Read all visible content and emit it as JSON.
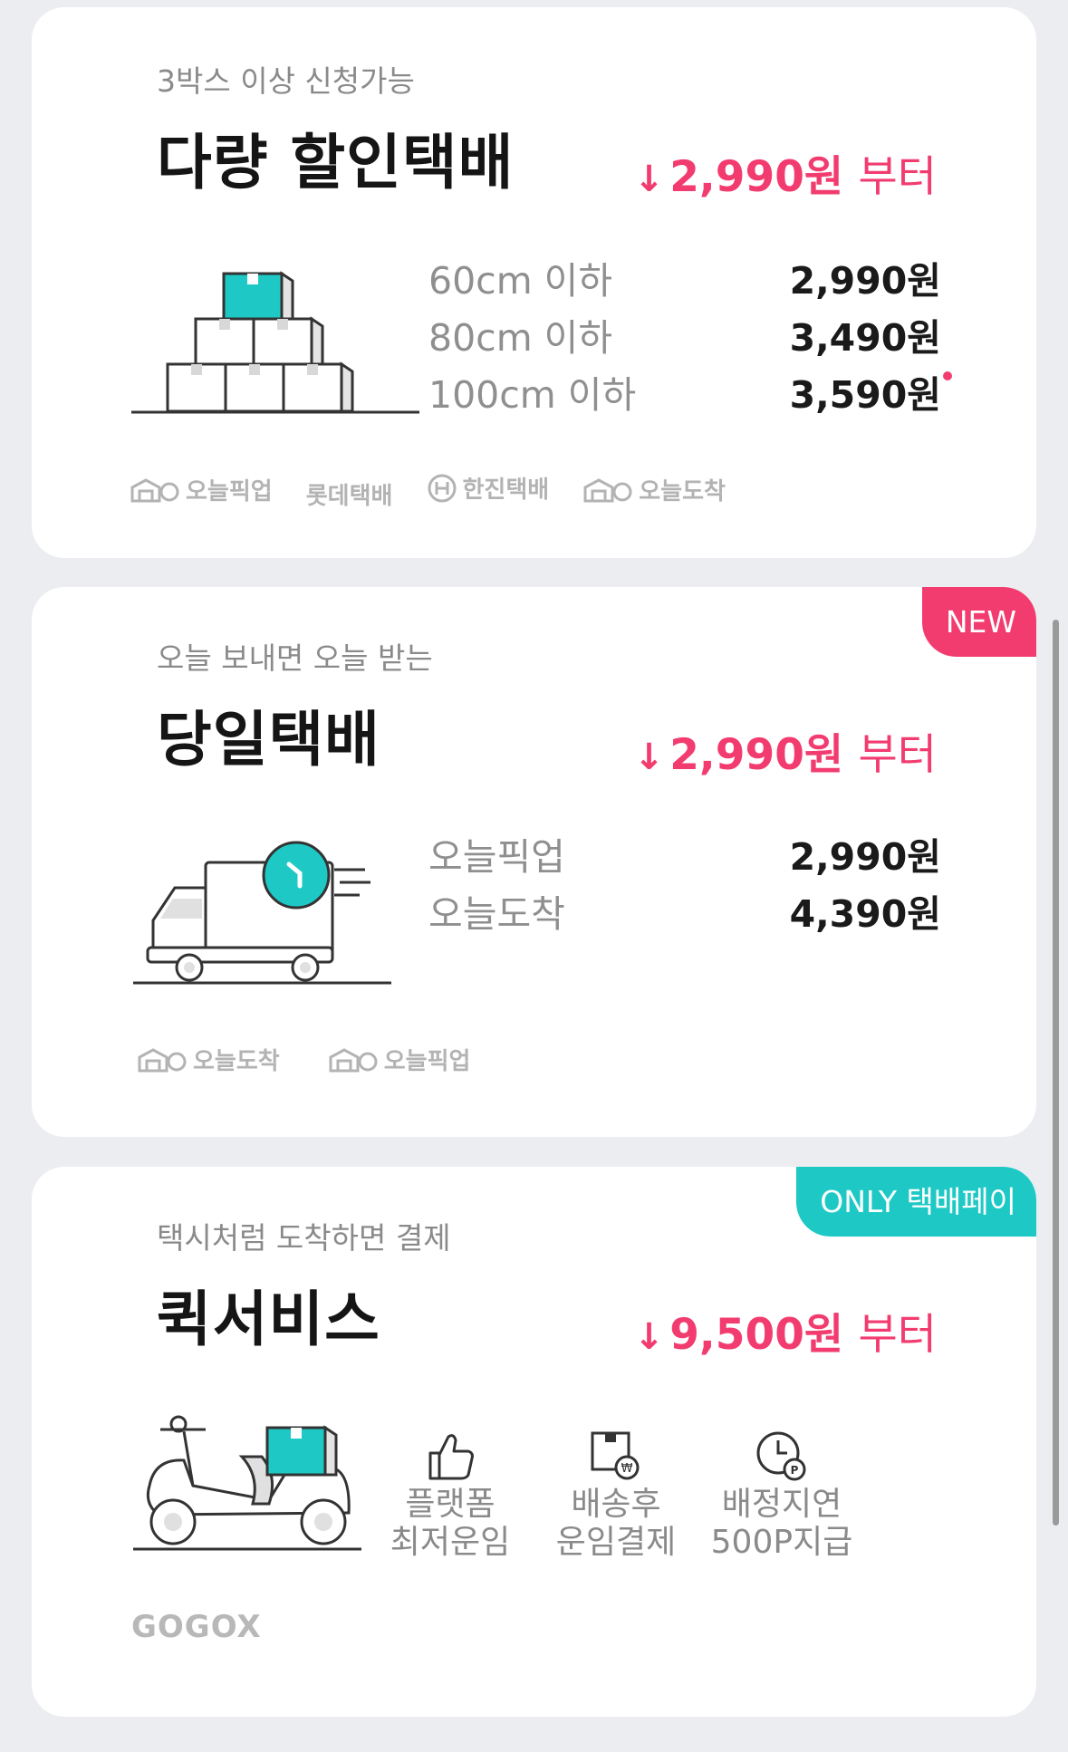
{
  "cards": [
    {
      "subtitle": "3박스 이상 신청가능",
      "title": "다량 할인택배",
      "from_arrow": "↓",
      "from_price": "2,990원",
      "from_word": "부터",
      "rows": [
        {
          "label": "60cm 이하",
          "price": "2,990원"
        },
        {
          "label": "80cm 이하",
          "price": "3,490원"
        },
        {
          "label": "100cm 이하",
          "price": "3,590원"
        }
      ],
      "carriers": [
        "오늘픽업",
        "롯데택배",
        "한진택배",
        "오늘도착"
      ],
      "illustration_icon": "box-pyramid-icon"
    },
    {
      "badge": "NEW",
      "subtitle": "오늘 보내면 오늘 받는",
      "title": "당일택배",
      "from_arrow": "↓",
      "from_price": "2,990원",
      "from_word": "부터",
      "rows": [
        {
          "label": "오늘픽업",
          "price": "2,990원"
        },
        {
          "label": "오늘도착",
          "price": "4,390원"
        }
      ],
      "carriers": [
        "오늘도착",
        "오늘픽업"
      ],
      "illustration_icon": "delivery-truck-icon"
    },
    {
      "badge": "ONLY 택배페이",
      "subtitle": "택시처럼 도착하면 결제",
      "title": "퀵서비스",
      "from_arrow": "↓",
      "from_price": "9,500원",
      "from_word": "부터",
      "features": [
        {
          "line1": "플랫폼",
          "line2": "최저운임",
          "icon": "thumbs-up-icon"
        },
        {
          "line1": "배송후",
          "line2": "운임결제",
          "icon": "box-won-icon"
        },
        {
          "line1": "배정지연",
          "line2": "500P지급",
          "icon": "clock-points-icon"
        }
      ],
      "partner": "GOGOX",
      "illustration_icon": "scooter-icon"
    }
  ],
  "colors": {
    "accent": "#f23c70",
    "teal": "#1ec9c5",
    "background": "#ecedf0"
  }
}
